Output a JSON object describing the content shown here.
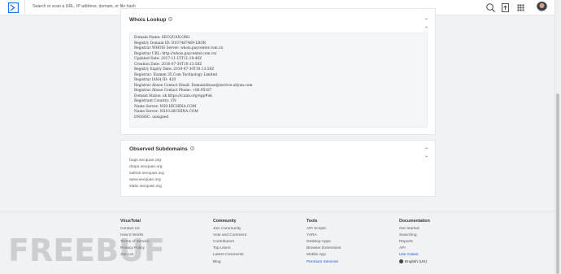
{
  "topbar": {
    "search_placeholder": "Search or scan a URL, IP address, domain, or file hash"
  },
  "whois": {
    "title": "Whois Lookup",
    "lines": [
      "Domain Name: SECQUAN.ORG",
      "Registry Domain ID: D107487469-LROR",
      "Registrar WHOIS Server: whois.paycenter.com.cn",
      "Registrar URL: http://whois.paycenter.com.cn/",
      "Updated Date: 2017-11-15T11:19:40Z",
      "Creation Date: 2016-07-30T10:13:58Z",
      "Registry Expiry Date: 2019-07-30T10:13:58Z",
      "Registrar: Xiamen 35.Com Technology Limited",
      "Registrar IANA ID: 420",
      "Registrar Abuse Contact Email: DomainAbuse@service.aliyun.com",
      "Registrar Abuse Contact Phone: +86.95187",
      "Domain Status: ok https://icann.org/epp#ok",
      "Registrant Country: CN",
      "Name Server: NS9.HICHINA.COM",
      "Name Server: NS10.HICHINA.COM",
      "DNSSEC: unsigned"
    ]
  },
  "subdomains": {
    "title": "Observed Subdomains",
    "items": [
      "bugs.secquan.org",
      "drops.secquan.org",
      "iadmin.secquan.org",
      "www.secquan.org",
      "static.secquan.org"
    ]
  },
  "footer": {
    "virustotal": {
      "heading": "VirusTotal",
      "links": [
        "Contact Us",
        "How It Works",
        "Terms of Service",
        "Privacy Policy",
        "Join Us"
      ]
    },
    "community": {
      "heading": "Community",
      "links": [
        "Join Community",
        "Vote and Comment",
        "Contributors",
        "Top Users",
        "Latest Comments",
        "Blog"
      ]
    },
    "tools": {
      "heading": "Tools",
      "links": [
        "API Scripts",
        "YARA",
        "Desktop Apps",
        "Browser Extensions",
        "Mobile App",
        "Premium Services"
      ]
    },
    "documentation": {
      "heading": "Documentation",
      "links": [
        "Get Started",
        "Searching",
        "Reports",
        "API",
        "Use Cases"
      ],
      "language": "English (US)"
    }
  },
  "watermark": "FREEBUF",
  "colors": {
    "accent": "#1a73e8",
    "link_blue": "#1b57d8",
    "background": "#f1f2f4"
  },
  "icons": [
    "virustotal-logo-icon",
    "search-icon",
    "upload-icon",
    "grid-apps-icon",
    "collapse-chevrons-icon",
    "info-icon",
    "globe-icon"
  ]
}
